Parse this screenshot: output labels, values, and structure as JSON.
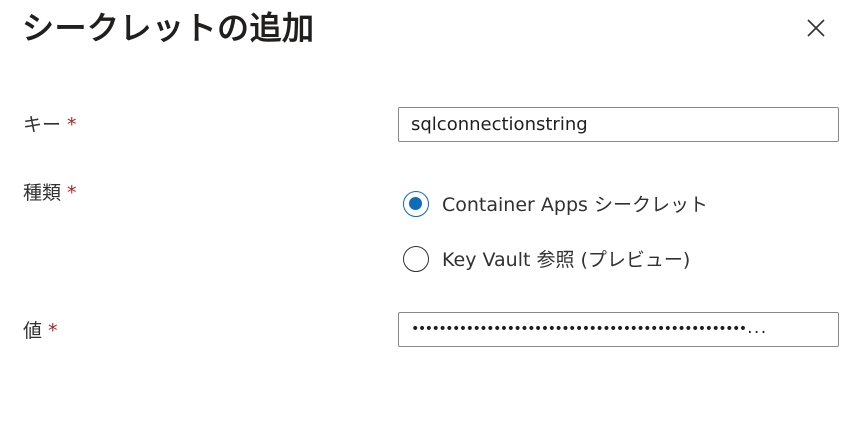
{
  "dialog": {
    "title": "シークレットの追加",
    "close_icon": "close-icon"
  },
  "fields": {
    "key": {
      "label": "キー",
      "required_mark": "*",
      "value": "sqlconnectionstring"
    },
    "type": {
      "label": "種類",
      "required_mark": "*",
      "options": [
        {
          "label": "Container Apps シークレット",
          "selected": true
        },
        {
          "label": "Key Vault 参照 (プレビュー)",
          "selected": false
        }
      ]
    },
    "value": {
      "label": "値",
      "required_mark": "*",
      "masked_value": "•••••••••••••••••••••••••••••••••••••••••••••••••..."
    }
  },
  "colors": {
    "accent": "#0f6cbd",
    "required": "#a4262c",
    "border": "#8a8886",
    "text": "#323130"
  }
}
